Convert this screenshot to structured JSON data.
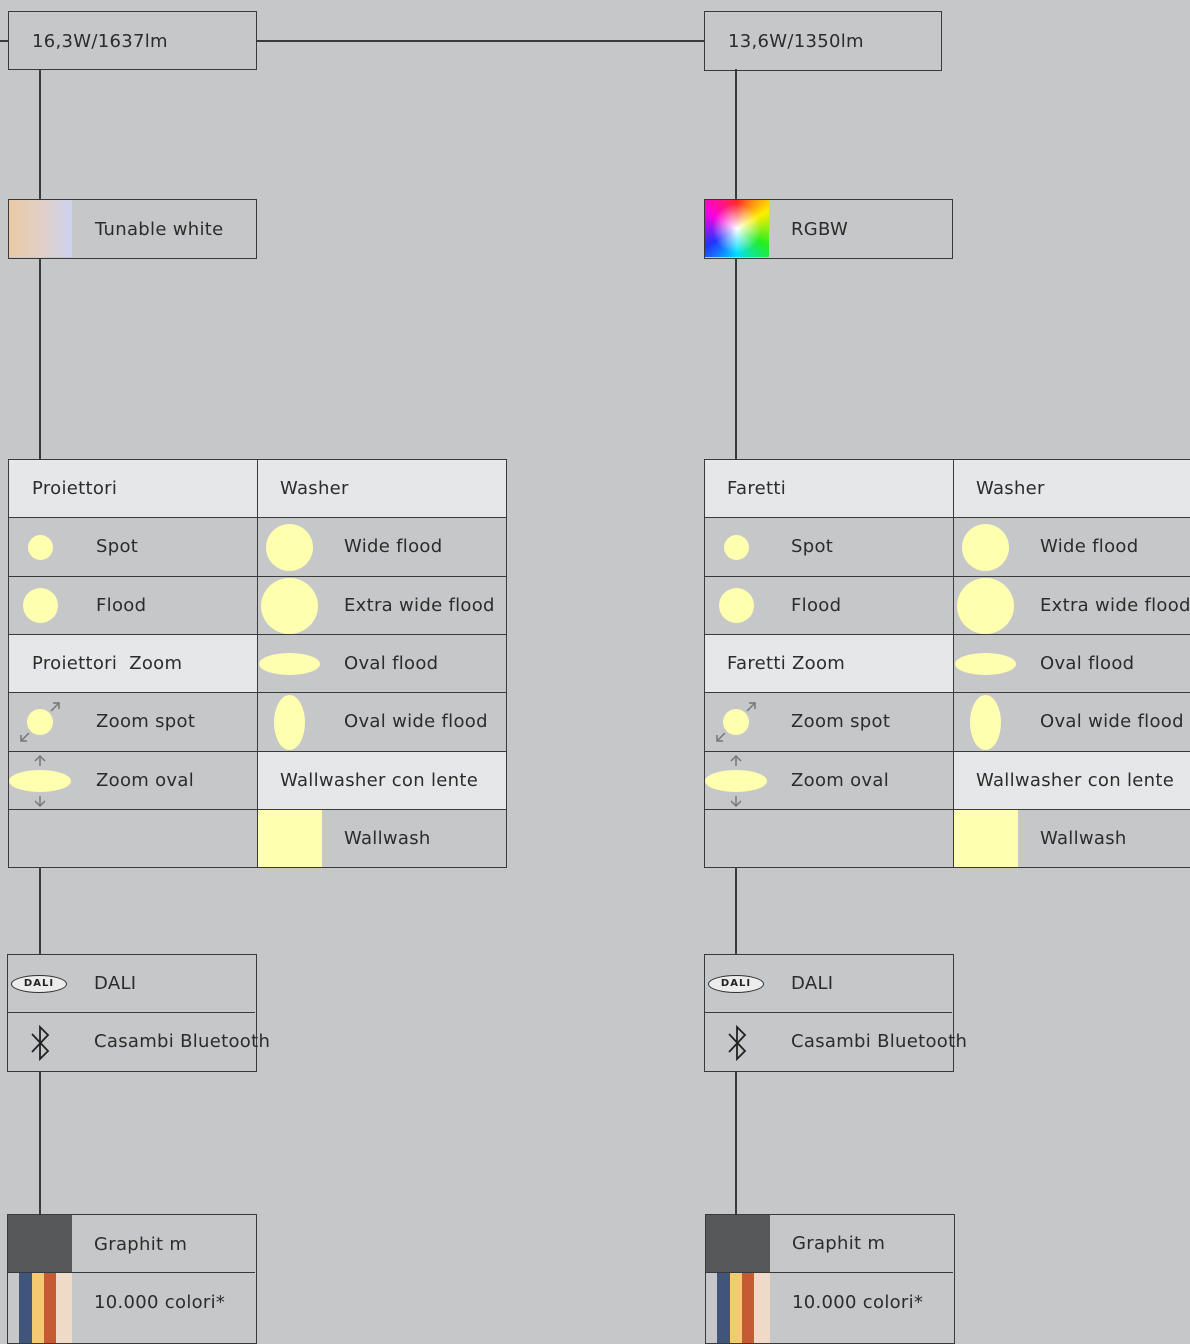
{
  "left": {
    "power": "16,3W/1637lm",
    "color_mode": "Tunable white",
    "head_a": "Proiettori",
    "head_b": "Washer",
    "spot": "Spot",
    "flood": "Flood",
    "zoom_head": "Proiettori  Zoom",
    "zoom_spot": "Zoom spot",
    "zoom_oval": "Zoom oval",
    "wide_flood": "Wide flood",
    "extra_wide_flood": "Extra wide flood",
    "oval_flood": "Oval flood",
    "oval_wide_flood": "Oval wide flood",
    "wallwasher": "Wallwasher con lente",
    "wallwash": "Wallwash",
    "dali": "DALI",
    "dali_logo": "DALI",
    "bluetooth": "Casambi Bluetooth",
    "finish": "Graphit m",
    "colors": "10.000 colori*"
  },
  "right": {
    "power": "13,6W/1350lm",
    "color_mode": "RGBW",
    "head_a": "Faretti",
    "head_b": "Washer",
    "spot": "Spot",
    "flood": "Flood",
    "zoom_head": "Faretti Zoom",
    "zoom_spot": "Zoom spot",
    "zoom_oval": "Zoom oval",
    "wide_flood": "Wide flood",
    "extra_wide_flood": "Extra wide flood",
    "oval_flood": "Oval flood",
    "oval_wide_flood": "Oval wide flood",
    "wallwasher": "Wallwasher con lente",
    "wallwash": "Wallwash",
    "dali": "DALI",
    "dali_logo": "DALI",
    "bluetooth": "Casambi Bluetooth",
    "finish": "Graphit m",
    "colors": "10.000 colori*"
  },
  "colors": {
    "background": "#c6c7c8",
    "header_cell": "#e6e7e8",
    "beam_shape": "#ffffb0",
    "graphit": "#56585a",
    "stripes": [
      "#3f5579",
      "#f3c972",
      "#c65a34",
      "#eedac6"
    ]
  }
}
